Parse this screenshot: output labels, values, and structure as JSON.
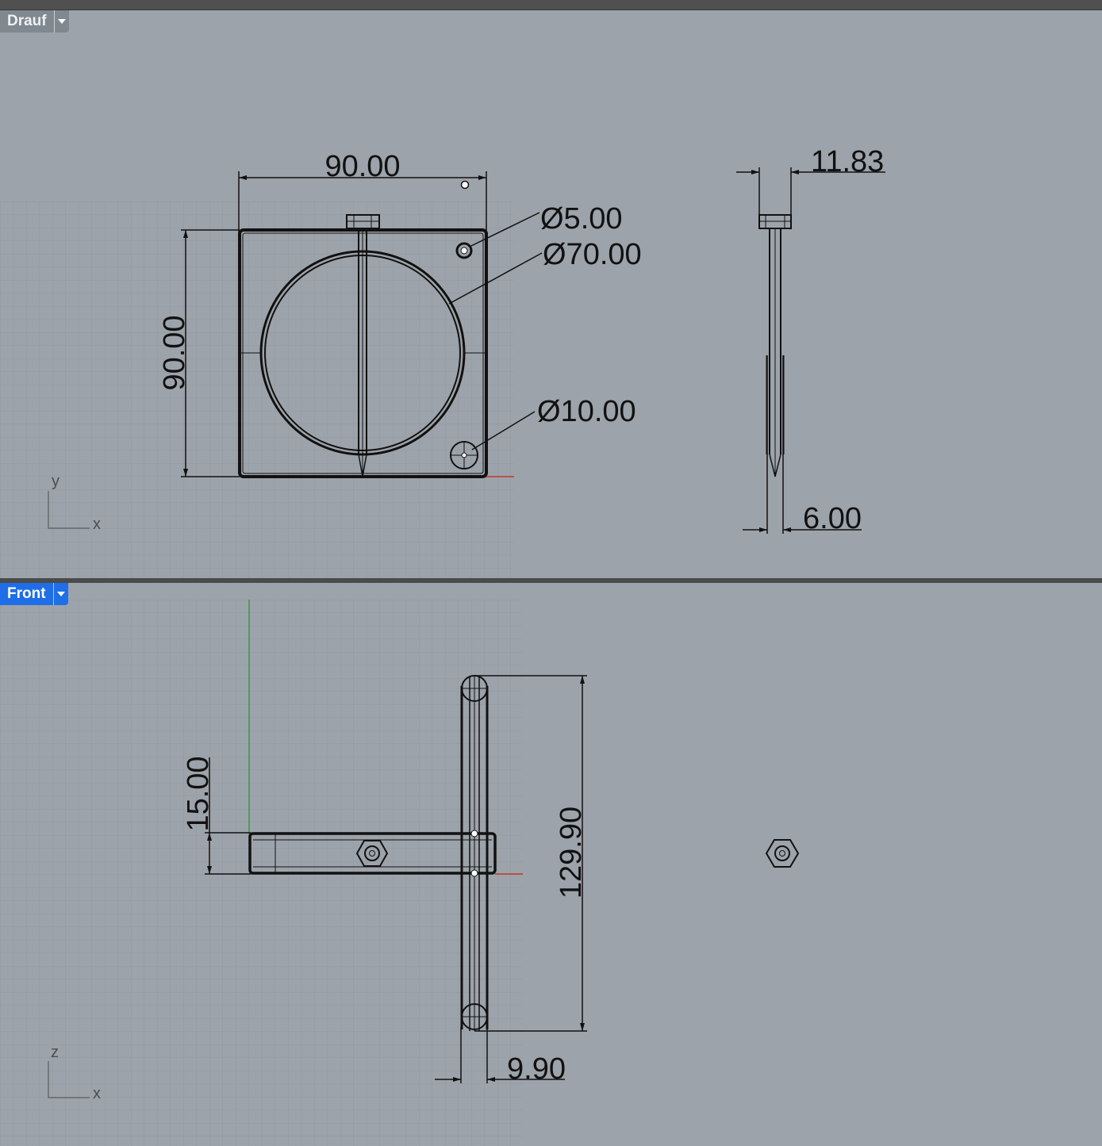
{
  "viewports": {
    "top": {
      "label": "Drauf",
      "active": false
    },
    "front": {
      "label": "Front",
      "active": true
    }
  },
  "top_view": {
    "dims": {
      "width": "90.00",
      "height": "90.00",
      "small_hole": "Ø5.00",
      "circle": "Ø70.00",
      "big_hole": "Ø10.00",
      "side_width": "11.83",
      "side_bottom": "6.00"
    },
    "axes": {
      "a": "y",
      "b": "x"
    }
  },
  "front_view": {
    "dims": {
      "thickness": "15.00",
      "length": "129.90",
      "width": "9.90"
    },
    "axes": {
      "a": "z",
      "b": "x"
    }
  },
  "colors": {
    "background": "#9da3aa",
    "grid": "#959ba1",
    "active_tab": "#1f6ee8",
    "inactive_tab": "#808890",
    "axis_x": "#c0392b",
    "axis_z": "#2e9e3f"
  }
}
